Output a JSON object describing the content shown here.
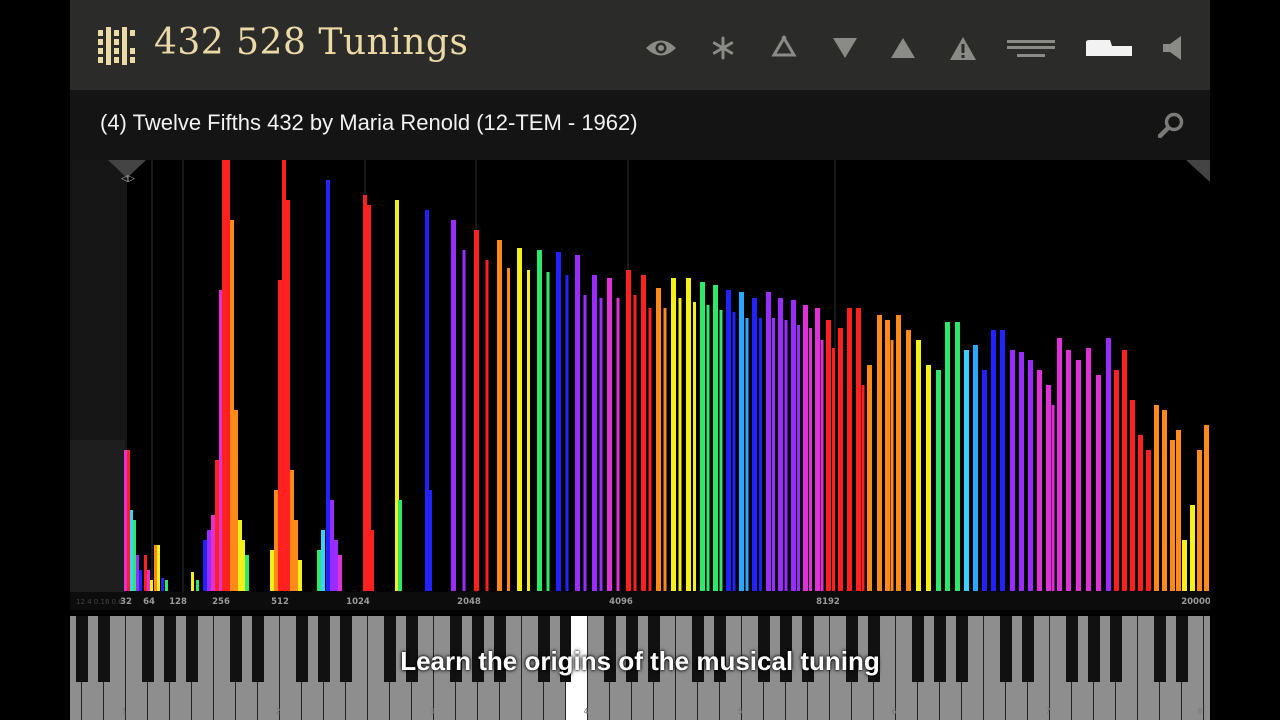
{
  "header": {
    "app_title": "432 528 Tunings",
    "icons": [
      "eye-icon",
      "snowflake-icon",
      "recycle-icon",
      "triangle-down-icon",
      "triangle-up-icon",
      "warning-icon",
      "keyboard-icon",
      "piano-toggle-icon",
      "speaker-icon"
    ]
  },
  "tuning": {
    "title": "(4) Twelve Fifths 432 by Maria Renold (12-TEM - 1962)"
  },
  "spectrum": {
    "freq_labels": [
      "32",
      "64",
      "128",
      "256",
      "512",
      "1024",
      "2048",
      "4096",
      "8192",
      "20000"
    ],
    "left_tick_text": "12.4  0.16  0.6",
    "colors": {
      "red": "#ff2020",
      "orange": "#ff8a1a",
      "yellow": "#f5f01a",
      "green": "#2ee86a",
      "blue": "#2222ff",
      "violet": "#9a2cff",
      "magenta": "#e030d8"
    }
  },
  "keyboard": {
    "octave_labels": [
      "1",
      "2",
      "3",
      "4",
      "5",
      "6",
      "7",
      "8"
    ],
    "highlighted_key": "4"
  },
  "subtitle": "Learn the origins of the musical tuning"
}
